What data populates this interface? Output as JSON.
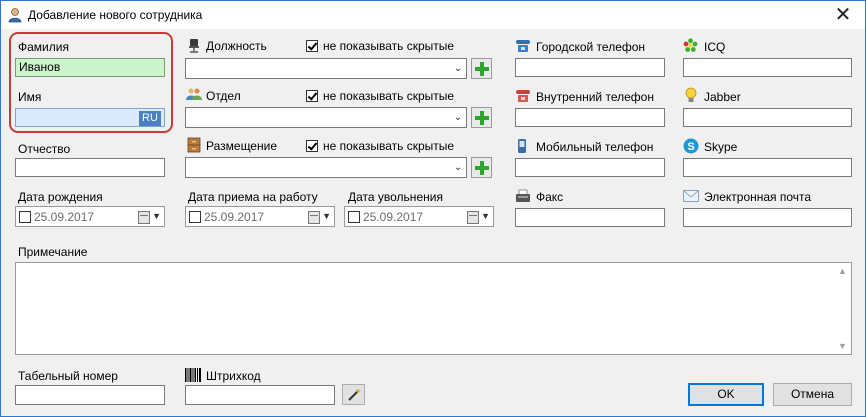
{
  "window": {
    "title": "Добавление нового сотрудника",
    "close_glyph": "✕"
  },
  "fields": {
    "last_name": {
      "label": "Фамилия",
      "value": "Иванов"
    },
    "first_name": {
      "label": "Имя",
      "value": "",
      "lang_badge": "RU"
    },
    "middle_name": {
      "label": "Отчество",
      "value": ""
    },
    "birth_date": {
      "label": "Дата рождения",
      "value": "25.09.2017"
    },
    "hire_date": {
      "label": "Дата приема на работу",
      "value": "25.09.2017"
    },
    "dismiss_date": {
      "label": "Дата увольнения",
      "value": "25.09.2017"
    },
    "note": {
      "label": "Примечание",
      "value": ""
    },
    "personnel_number": {
      "label": "Табельный номер",
      "value": ""
    },
    "barcode": {
      "label": "Штрихкод",
      "value": ""
    }
  },
  "lookups": {
    "position": {
      "label": "Должность",
      "hide_label": "не показывать скрытые",
      "hide_checked": true,
      "value": ""
    },
    "department": {
      "label": "Отдел",
      "hide_label": "не показывать скрытые",
      "hide_checked": true,
      "value": ""
    },
    "placement": {
      "label": "Размещение",
      "hide_label": "не показывать скрытые",
      "hide_checked": true,
      "value": ""
    }
  },
  "contacts": {
    "city_phone": {
      "label": "Городской телефон",
      "value": "",
      "icon": "landline-phone-icon"
    },
    "internal_phone": {
      "label": "Внутренний телефон",
      "value": "",
      "icon": "internal-phone-icon"
    },
    "mobile_phone": {
      "label": "Мобильный телефон",
      "value": "",
      "icon": "mobile-phone-icon"
    },
    "fax": {
      "label": "Факс",
      "value": "",
      "icon": "fax-icon"
    },
    "icq": {
      "label": "ICQ",
      "value": "",
      "icon": "icq-flower-icon"
    },
    "jabber": {
      "label": "Jabber",
      "value": "",
      "icon": "lightbulb-icon"
    },
    "skype": {
      "label": "Skype",
      "value": "",
      "icon": "skype-icon"
    },
    "email": {
      "label": "Электронная почта",
      "value": "",
      "icon": "envelope-icon"
    }
  },
  "buttons": {
    "ok": "OK",
    "cancel": "Отмена"
  },
  "colors": {
    "accent": "#0078d7",
    "highlight_frame": "#c93a3a",
    "valid_field": "#ccf5cc",
    "focus_field": "#dcebfb",
    "plus_green": "#2ea52e"
  }
}
